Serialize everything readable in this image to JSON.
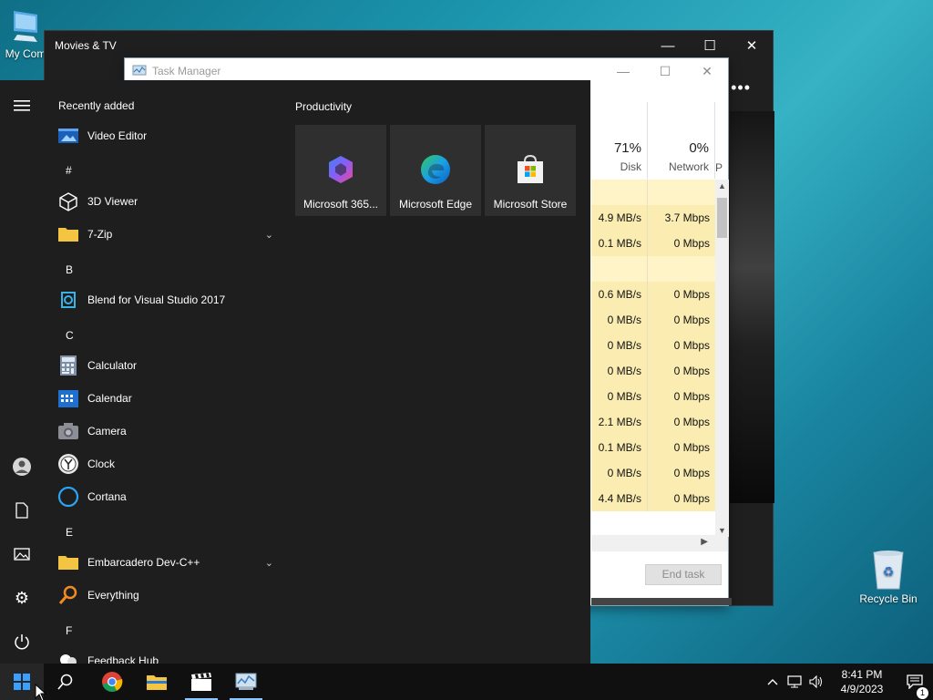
{
  "desktop": {
    "my_computer_label": "My Com",
    "recycle_bin_label": "Recycle Bin"
  },
  "movies_window": {
    "title": "Movies & TV",
    "minimize": "—",
    "maximize": "☐",
    "close": "✕",
    "more": "•••"
  },
  "task_manager": {
    "title": "Task Manager",
    "disk_header": {
      "pct": "71%",
      "label": "Disk"
    },
    "network_header": {
      "pct": "0%",
      "label": "Network"
    },
    "power_header": "P",
    "rows": [
      {
        "disk": "",
        "network": ""
      },
      {
        "disk": "4.9 MB/s",
        "network": "3.7 Mbps"
      },
      {
        "disk": "0.1 MB/s",
        "network": "0 Mbps"
      },
      {
        "disk": "",
        "network": ""
      },
      {
        "disk": "0.6 MB/s",
        "network": "0 Mbps"
      },
      {
        "disk": "0 MB/s",
        "network": "0 Mbps"
      },
      {
        "disk": "0 MB/s",
        "network": "0 Mbps"
      },
      {
        "disk": "0 MB/s",
        "network": "0 Mbps"
      },
      {
        "disk": "0 MB/s",
        "network": "0 Mbps"
      },
      {
        "disk": "2.1 MB/s",
        "network": "0 Mbps"
      },
      {
        "disk": "0.1 MB/s",
        "network": "0 Mbps"
      },
      {
        "disk": "0 MB/s",
        "network": "0 Mbps"
      },
      {
        "disk": "4.4 MB/s",
        "network": "0 Mbps"
      }
    ],
    "end_task": "End task"
  },
  "start_menu": {
    "recently_added": "Recently added",
    "productivity_title": "Productivity",
    "letters": {
      "hash": "#",
      "b": "B",
      "c": "C",
      "e": "E",
      "f": "F"
    },
    "apps": {
      "video_editor": "Video Editor",
      "viewer_3d": "3D Viewer",
      "zip7": "7-Zip",
      "blend": "Blend for Visual Studio 2017",
      "calculator": "Calculator",
      "calendar": "Calendar",
      "camera": "Camera",
      "clock": "Clock",
      "cortana": "Cortana",
      "embarcadero": "Embarcadero Dev-C++",
      "everything": "Everything",
      "feedback": "Feedback Hub"
    },
    "tiles": [
      {
        "label": "Microsoft 365..."
      },
      {
        "label": "Microsoft Edge"
      },
      {
        "label": "Microsoft Store"
      }
    ]
  },
  "taskbar": {
    "time": "8:41 PM",
    "date": "4/9/2023",
    "notification_count": "1"
  }
}
